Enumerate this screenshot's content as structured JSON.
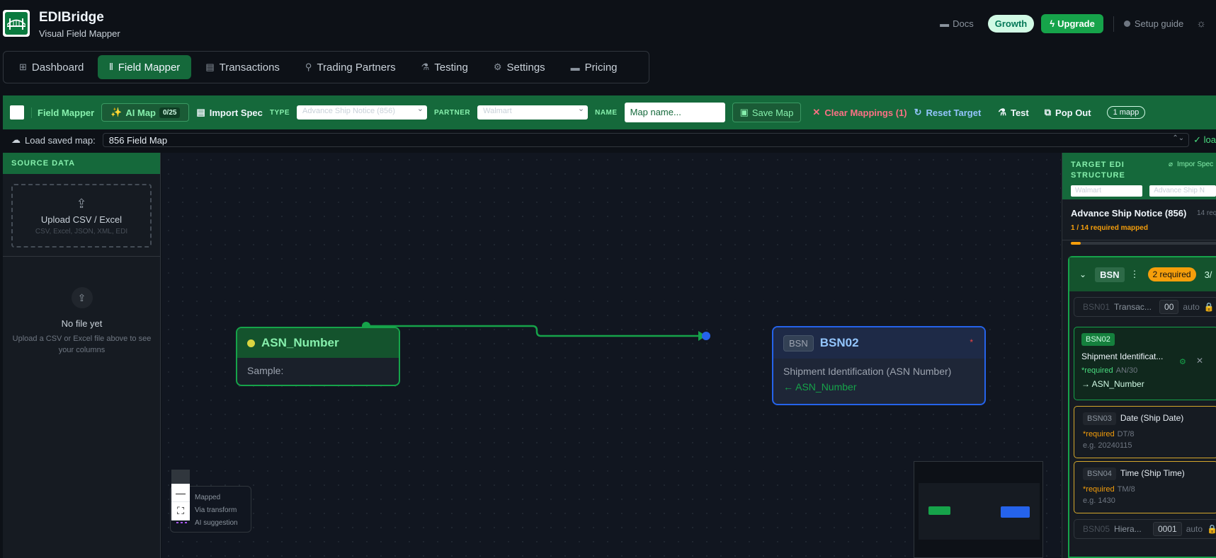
{
  "app": {
    "name": "EDIBridge",
    "subtitle": "Visual Field Mapper"
  },
  "header": {
    "docs": "Docs",
    "plan": "Growth",
    "upgrade": "Upgrade",
    "setup": "Setup guide"
  },
  "nav": [
    "Dashboard",
    "Field Mapper",
    "Transactions",
    "Trading Partners",
    "Testing",
    "Settings",
    "Pricing"
  ],
  "toolbar": {
    "title": "Field Mapper",
    "ai_map": "AI Map",
    "ai_count": "0/25",
    "import_spec": "Import Spec",
    "type_label": "TYPE",
    "type_value": "Advance Ship Notice (856)",
    "partner_label": "PARTNER",
    "partner_value": "Walmart",
    "name_label": "NAME",
    "name_placeholder": "Map name...",
    "save_map": "Save Map",
    "clear_mappings": "Clear Mappings (1)",
    "reset_target": "Reset Target",
    "test": "Test",
    "pop_out": "Pop Out",
    "mapped_badge": "1 mapp"
  },
  "load": {
    "label": "Load saved map:",
    "value": "856 Field Map",
    "status": "loa"
  },
  "source": {
    "header": "SOURCE DATA",
    "upload_title": "Upload CSV / Excel",
    "upload_formats": "CSV, Excel, JSON, XML, EDI",
    "empty_title": "No file yet",
    "empty_desc": "Upload a CSV or Excel file above to see your columns"
  },
  "canvas": {
    "source_node": {
      "title": "ASN_Number",
      "sample": "Sample:"
    },
    "target_node": {
      "badge": "BSN",
      "title": "BSN02",
      "required_mark": "*",
      "desc": "Shipment Identification (ASN Number)",
      "mapped_from": "← ASN_Number"
    },
    "legend": [
      "Mapped",
      "Via transform",
      "AI suggestion"
    ],
    "controls": {
      "zoom_out": "—"
    }
  },
  "target": {
    "header": "TARGET EDI STRUCTURE",
    "import": "Impor Spec",
    "partner": "Walmart",
    "type": "Advance Ship N",
    "doc_title": "Advance Ship Notice (856)",
    "doc_count": "14 req",
    "progress_text": "1 / 14 required mapped",
    "progress": 0.07,
    "segment": {
      "name": "BSN",
      "required": "2 required",
      "frac": "3/"
    },
    "elements": [
      {
        "id": "BSN01",
        "title": "Transac...",
        "value": "00",
        "auto": "auto"
      },
      {
        "id": "BSN02",
        "title": "Shipment Identificat...",
        "req": "*required",
        "type": "AN/30",
        "link": "ASN_Number"
      },
      {
        "id": "BSN03",
        "title": "Date (Ship Date)",
        "req": "*required",
        "type": "DT/8",
        "eg": "e.g. 20240115"
      },
      {
        "id": "BSN04",
        "title": "Time (Ship Time)",
        "req": "*required",
        "type": "TM/8",
        "eg": "e.g. 1430"
      },
      {
        "id": "BSN05",
        "title": "Hiera...",
        "value": "0001",
        "auto": "auto"
      }
    ]
  },
  "colors": {
    "brand_green": "#15693b",
    "accent_green": "#16a34a",
    "target_blue": "#2563eb",
    "warning": "#f59e0b"
  }
}
